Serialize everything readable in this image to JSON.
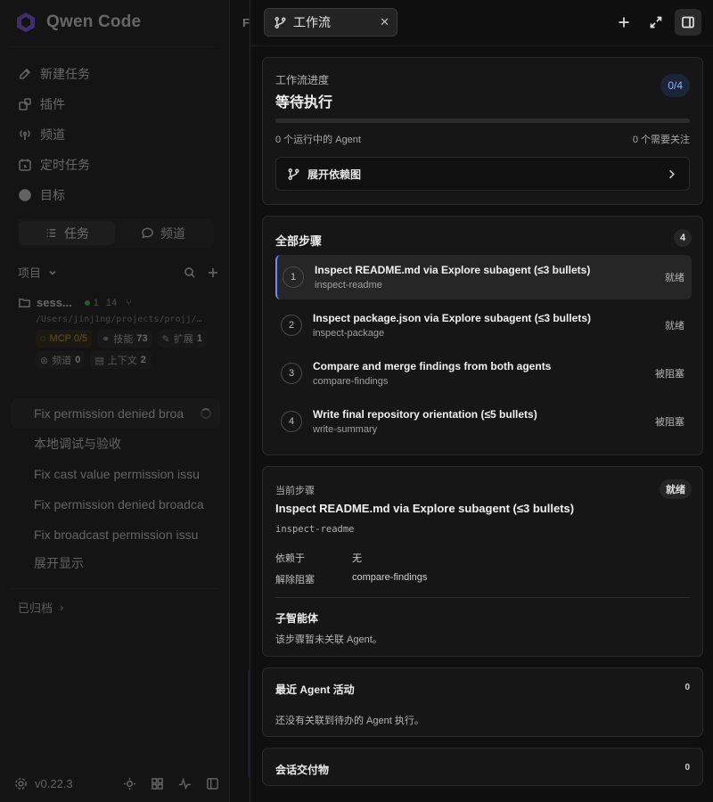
{
  "app": {
    "name": "Qwen Code",
    "version": "v0.22.3"
  },
  "sidebar": {
    "nav": [
      {
        "label": "新建任务",
        "icon": "edit-icon"
      },
      {
        "label": "插件",
        "icon": "puzzle-icon"
      },
      {
        "label": "频道",
        "icon": "broadcast-icon"
      },
      {
        "label": "定时任务",
        "icon": "calendar-clock-icon"
      },
      {
        "label": "目标",
        "icon": "target-icon"
      }
    ],
    "segment": {
      "tasks": "任务",
      "channels": "频道",
      "active": "任务"
    },
    "projects_label": "项目",
    "session": {
      "name": "sess...",
      "running": "1",
      "count": "14",
      "path": "/Users/jinjing/projects/projj/…",
      "chips": {
        "mcp": "MCP 0/5",
        "skills_label": "技能",
        "skills": "73",
        "ext_label": "扩展",
        "ext": "1",
        "chan_label": "频道",
        "chan": "0",
        "ctx_label": "上下文",
        "ctx": "2"
      }
    },
    "tasks": [
      "Fix permission denied broa",
      "本地调试与验收",
      "Fix cast value permission issu",
      "Fix permission denied broadca",
      "Fix broadcast permission issu"
    ],
    "show_more": "展开显示",
    "archived": "已归档"
  },
  "midstrip_letter": "F",
  "panel": {
    "tab_label": "工作流",
    "progress": {
      "label": "工作流进度",
      "status": "等待执行",
      "ratio": "0/4",
      "fraction": 0,
      "running_agents": "0 个运行中的 Agent",
      "need_attention": "0 个需要关注",
      "expand_graph": "展开依赖图"
    },
    "steps": {
      "title": "全部步骤",
      "count": "4",
      "items": [
        {
          "num": "1",
          "title": "Inspect README.md via Explore subagent (≤3 bullets)",
          "id": "inspect-readme",
          "status": "就绪"
        },
        {
          "num": "2",
          "title": "Inspect package.json via Explore subagent (≤3 bullets)",
          "id": "inspect-package",
          "status": "就绪"
        },
        {
          "num": "3",
          "title": "Compare and merge findings from both agents",
          "id": "compare-findings",
          "status": "被阻塞"
        },
        {
          "num": "4",
          "title": "Write final repository orientation (≤5 bullets)",
          "id": "write-summary",
          "status": "被阻塞"
        }
      ]
    },
    "current": {
      "label": "当前步骤",
      "badge": "就绪",
      "title": "Inspect README.md via Explore subagent (≤3 bullets)",
      "id": "inspect-readme",
      "depends_label": "依赖于",
      "depends_value": "无",
      "unblocks_label": "解除阻塞",
      "unblocks_value": "compare-findings",
      "sub_title": "子智能体",
      "sub_text": "该步骤暂未关联 Agent。"
    },
    "activity": {
      "title": "最近 Agent 活动",
      "count": "0",
      "text": "还没有关联到待办的 Agent 执行。"
    },
    "deliverables": {
      "title": "会话交付物",
      "count": "0"
    }
  },
  "colors": {
    "accent": "#6b8cff",
    "running": "#3fbf5e",
    "warn": "#c9a227"
  }
}
